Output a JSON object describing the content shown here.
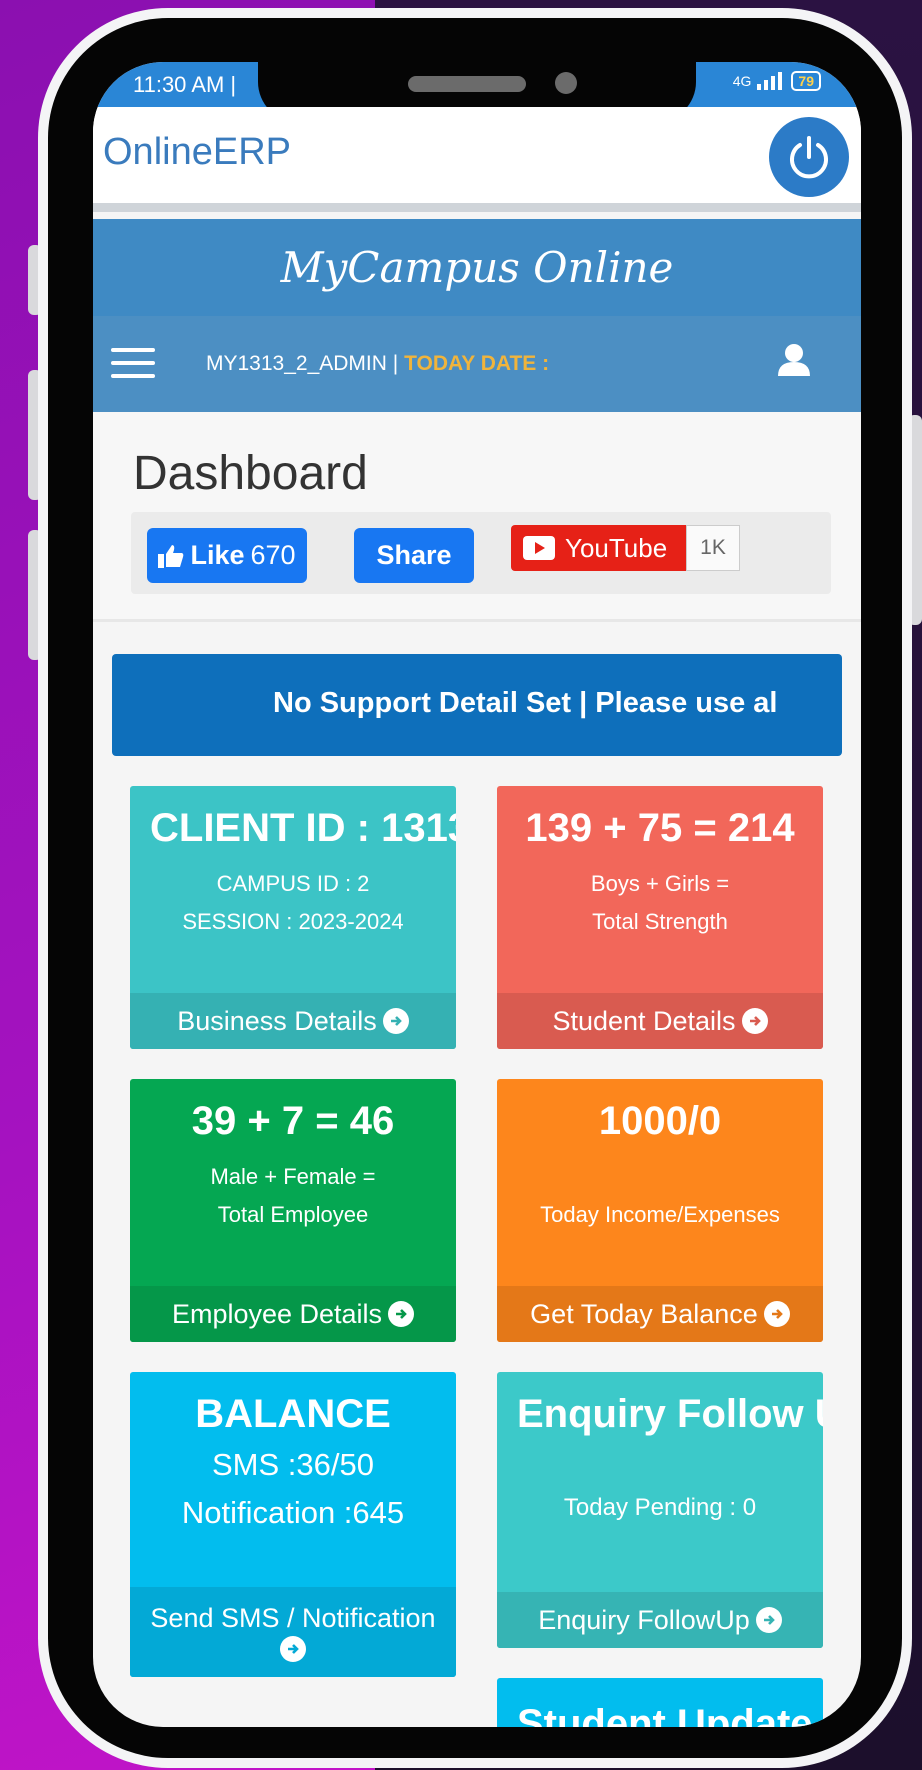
{
  "status": {
    "time": "11:30 AM |",
    "network": "4G",
    "battery": "79"
  },
  "app": {
    "title": "OnlineERP"
  },
  "banner": {
    "title": "MyCampus Online"
  },
  "nav": {
    "user": "MY1313_2_ADMIN |",
    "date_label": "TODAY DATE :"
  },
  "dashboard": {
    "title": "Dashboard",
    "like_label": "Like",
    "like_count": "670",
    "share_label": "Share",
    "youtube_label": "YouTube",
    "youtube_count": "1K"
  },
  "support": {
    "text": "No Support Detail Set   |   Please use al"
  },
  "cards": [
    {
      "head": "CLIENT ID : 1313",
      "sub1": "CAMPUS ID : 2",
      "sub2": "SESSION : 2023-2024",
      "foot": "Business Details",
      "color": "#3cc4c6",
      "foot_color": "#35b1b3"
    },
    {
      "head": "139 + 75 = 214",
      "sub1": "Boys + Girls =",
      "sub2": "Total Strength",
      "foot": "Student Details",
      "color": "#f2675a",
      "foot_color": "#d95b50"
    },
    {
      "head": "39 + 7 = 46",
      "sub1": "Male + Female =",
      "sub2": "Total Employee",
      "foot": "Employee Details",
      "color": "#05a752",
      "foot_color": "#059749"
    },
    {
      "head": "1000/0",
      "sub1": "",
      "sub2": "Today Income/Expenses",
      "foot": "Get Today Balance",
      "color": "#fd861c",
      "foot_color": "#e47818"
    },
    {
      "head": "BALANCE",
      "sub1": "SMS :36/50",
      "sub2": "Notification :645",
      "foot": "Send SMS / Notification",
      "color": "#02bdee",
      "foot_color": "#03a9d6"
    },
    {
      "head": "Enquiry Follow U",
      "sub1": "",
      "sub2": "Today Pending : 0",
      "foot": "Enquiry FollowUp",
      "color": "#3cc9c9",
      "foot_color": "#36b4b4"
    },
    {
      "head": "Student Update",
      "color": "#02bdee"
    }
  ]
}
